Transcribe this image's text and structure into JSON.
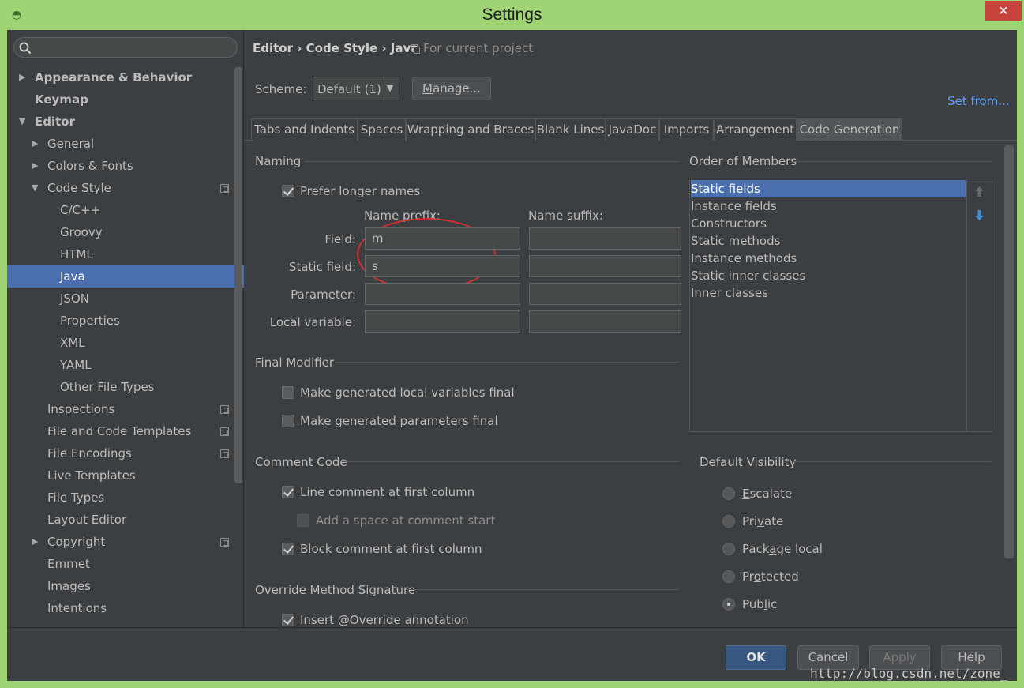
{
  "window": {
    "title": "Settings",
    "close_glyph": "✕"
  },
  "search": {
    "placeholder": ""
  },
  "sidebar": {
    "items": [
      {
        "label": "Appearance & Behavior",
        "arrow": "▶",
        "bold": true
      },
      {
        "label": "Keymap",
        "arrow": "",
        "bold": true
      },
      {
        "label": "Editor",
        "arrow": "▼",
        "bold": true
      },
      {
        "label": "General",
        "arrow": "▶"
      },
      {
        "label": "Colors & Fonts",
        "arrow": "▶"
      },
      {
        "label": "Code Style",
        "arrow": "▼",
        "copy_icon": true
      },
      {
        "label": "C/C++"
      },
      {
        "label": "Groovy"
      },
      {
        "label": "HTML"
      },
      {
        "label": "Java",
        "selected": true
      },
      {
        "label": "JSON"
      },
      {
        "label": "Properties"
      },
      {
        "label": "XML"
      },
      {
        "label": "YAML"
      },
      {
        "label": "Other File Types"
      },
      {
        "label": "Inspections",
        "copy_icon": true
      },
      {
        "label": "File and Code Templates",
        "copy_icon": true
      },
      {
        "label": "File Encodings",
        "copy_icon": true
      },
      {
        "label": "Live Templates"
      },
      {
        "label": "File Types"
      },
      {
        "label": "Layout Editor"
      },
      {
        "label": "Copyright",
        "arrow": "▶",
        "copy_icon": true
      },
      {
        "label": "Emmet"
      },
      {
        "label": "Images"
      },
      {
        "label": "Intentions"
      }
    ]
  },
  "breadcrumb": {
    "path": "Editor › Code Style › Java",
    "project": "For current project"
  },
  "scheme": {
    "label": "Scheme:",
    "value": "Default (1)",
    "manage_label": "Manage...",
    "set_from": "Set from..."
  },
  "tabs": [
    "Tabs and Indents",
    "Spaces",
    "Wrapping and Braces",
    "Blank Lines",
    "JavaDoc",
    "Imports",
    "Arrangement",
    "Code Generation"
  ],
  "active_tab": "Code Generation",
  "naming": {
    "title": "Naming",
    "prefer_longer": "Prefer longer names",
    "prefix_header": "Name prefix:",
    "suffix_header": "Name suffix:",
    "rows": [
      {
        "label": "Field:",
        "prefix": "m",
        "suffix": ""
      },
      {
        "label": "Static field:",
        "prefix": "s",
        "suffix": ""
      },
      {
        "label": "Parameter:",
        "prefix": "",
        "suffix": ""
      },
      {
        "label": "Local variable:",
        "prefix": "",
        "suffix": ""
      }
    ]
  },
  "final_modifier": {
    "title": "Final Modifier",
    "local_vars": "Make generated local variables final",
    "params": "Make generated parameters final"
  },
  "comment_code": {
    "title": "Comment Code",
    "line_first": "Line comment at first column",
    "add_space": "Add a space at comment start",
    "block_first": "Block comment at first column"
  },
  "override": {
    "title": "Override Method Signature",
    "insert": "Insert @Override annotation"
  },
  "order": {
    "title": "Order of Members",
    "items": [
      "Static fields",
      "Instance fields",
      "Constructors",
      "Static methods",
      "Instance methods",
      "Static inner classes",
      "Inner classes"
    ]
  },
  "visibility": {
    "title": "Default Visibility",
    "options": [
      "Escalate",
      "Private",
      "Package local",
      "Protected",
      "Public"
    ],
    "selected": "Public"
  },
  "buttons": {
    "ok": "OK",
    "cancel": "Cancel",
    "apply": "Apply",
    "help": "Help"
  },
  "watermark": "http://blog.csdn.net/zone_"
}
